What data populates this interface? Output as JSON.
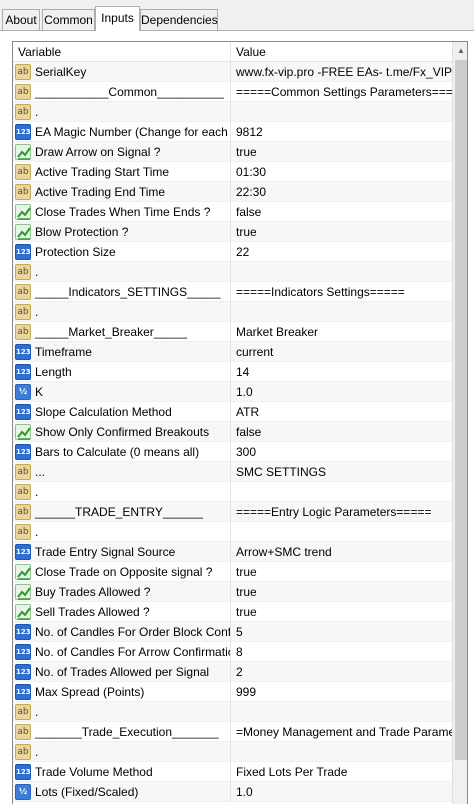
{
  "tabs": [
    {
      "label": "About"
    },
    {
      "label": "Common"
    },
    {
      "label": "Inputs"
    },
    {
      "label": "Dependencies"
    }
  ],
  "columns": {
    "variable": "Variable",
    "value": "Value"
  },
  "scrollbar": {
    "up_arrow": "▲"
  },
  "rows": [
    {
      "icon": "ab",
      "variable": "SerialKey",
      "value": "www.fx-vip.pro   -FREE EAs-   t.me/Fx_VIP"
    },
    {
      "icon": "ab",
      "variable": "___________Common__________",
      "value": "=====Common Settings Parameters====="
    },
    {
      "icon": "ab",
      "variable": ".",
      "value": ""
    },
    {
      "icon": "123",
      "variable": "EA Magic Number (Change for each C...",
      "value": "9812"
    },
    {
      "icon": "bool",
      "variable": "Draw Arrow on Signal ?",
      "value": "true"
    },
    {
      "icon": "ab",
      "variable": "Active Trading Start Time",
      "value": "01:30"
    },
    {
      "icon": "ab",
      "variable": "Active Trading End Time",
      "value": "22:30"
    },
    {
      "icon": "bool",
      "variable": "Close Trades When Time Ends ?",
      "value": "false"
    },
    {
      "icon": "bool",
      "variable": "Blow Protection ?",
      "value": "true"
    },
    {
      "icon": "123",
      "variable": "Protection Size",
      "value": "22"
    },
    {
      "icon": "ab",
      "variable": ".",
      "value": ""
    },
    {
      "icon": "ab",
      "variable": "_____Indicators_SETTINGS_____",
      "value": "=====Indicators Settings====="
    },
    {
      "icon": "ab",
      "variable": ".",
      "value": ""
    },
    {
      "icon": "ab",
      "variable": "_____Market_Breaker_____",
      "value": "Market Breaker"
    },
    {
      "icon": "123",
      "variable": "Timeframe",
      "value": "current"
    },
    {
      "icon": "123",
      "variable": "Length",
      "value": "14"
    },
    {
      "icon": "v2",
      "variable": "K",
      "value": "1.0"
    },
    {
      "icon": "123",
      "variable": "Slope Calculation Method",
      "value": "ATR"
    },
    {
      "icon": "bool",
      "variable": "Show Only Confirmed Breakouts",
      "value": "false"
    },
    {
      "icon": "123",
      "variable": "Bars to Calculate (0 means all)",
      "value": "300"
    },
    {
      "icon": "ab",
      "variable": "...",
      "value": "SMC SETTINGS"
    },
    {
      "icon": "ab",
      "variable": ".",
      "value": ""
    },
    {
      "icon": "ab",
      "variable": "______TRADE_ENTRY______",
      "value": "=====Entry Logic Parameters====="
    },
    {
      "icon": "ab",
      "variable": ".",
      "value": ""
    },
    {
      "icon": "123",
      "variable": "Trade Entry Signal Source",
      "value": "Arrow+SMC trend"
    },
    {
      "icon": "bool",
      "variable": "Close Trade on Opposite signal ?",
      "value": "true"
    },
    {
      "icon": "bool",
      "variable": "Buy Trades Allowed ?",
      "value": "true"
    },
    {
      "icon": "bool",
      "variable": "Sell Trades Allowed ?",
      "value": "true"
    },
    {
      "icon": "123",
      "variable": "No. of Candles For Order Block Confir...",
      "value": "5"
    },
    {
      "icon": "123",
      "variable": "No. of Candles For Arrow Confirmation",
      "value": "8"
    },
    {
      "icon": "123",
      "variable": "No. of Trades Allowed per Signal",
      "value": "2"
    },
    {
      "icon": "123",
      "variable": "Max Spread (Points)",
      "value": "999"
    },
    {
      "icon": "ab",
      "variable": ".",
      "value": ""
    },
    {
      "icon": "ab",
      "variable": "_______Trade_Execution_______",
      "value": "=Money Management and Trade Paramet..."
    },
    {
      "icon": "ab",
      "variable": ".",
      "value": ""
    },
    {
      "icon": "123",
      "variable": "Trade Volume Method",
      "value": "Fixed Lots Per Trade"
    },
    {
      "icon": "v2",
      "variable": "Lots (Fixed/Scaled)",
      "value": "1.0"
    }
  ]
}
